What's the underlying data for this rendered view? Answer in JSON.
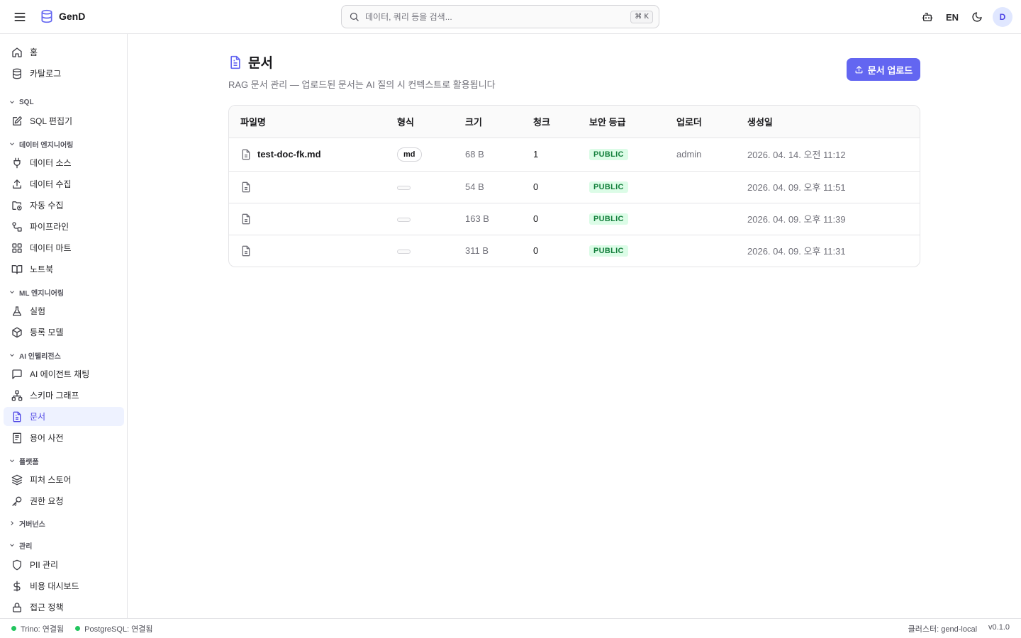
{
  "header": {
    "brand": "GenD",
    "search_placeholder": "데이터, 쿼리 등을 검색...",
    "search_shortcut": "⌘ K",
    "language": "EN",
    "avatar_initial": "D"
  },
  "sidebar": {
    "home": "홈",
    "catalog": "카탈로그",
    "sections": {
      "sql": "SQL",
      "data_engineering": "데이터 엔지니어링",
      "ml_engineering": "ML 엔지니어링",
      "ai_intelligence": "AI 인텔리전스",
      "platform": "플랫폼",
      "governance": "거버넌스",
      "admin": "관리"
    },
    "items": {
      "sql_editor": "SQL 편집기",
      "data_sources": "데이터 소스",
      "data_ingest": "데이터 수집",
      "auto_ingest": "자동 수집",
      "pipeline": "파이프라인",
      "data_mart": "데이터 마트",
      "notebook": "노트북",
      "experiments": "실험",
      "registered_models": "등록 모델",
      "ai_agent_chat": "AI 에이전트 채팅",
      "schema_graph": "스키마 그래프",
      "documents": "문서",
      "glossary": "용어 사전",
      "feature_store": "피처 스토어",
      "access_request": "권한 요청",
      "pii_management": "PII 관리",
      "cost_dashboard": "비용 대시보드",
      "access_policy": "접근 정책"
    }
  },
  "page": {
    "title": "문서",
    "subtitle": "RAG 문서 관리 — 업로드된 문서는 AI 질의 시 컨텍스트로 활용됩니다",
    "upload_button": "문서 업로드"
  },
  "table": {
    "columns": [
      "파일명",
      "형식",
      "크기",
      "청크",
      "보안 등급",
      "업로더",
      "생성일"
    ],
    "rows": [
      {
        "filename": "test-doc-fk.md",
        "format": "md",
        "size": "68 B",
        "chunks": "1",
        "security": "PUBLIC",
        "uploader": "admin",
        "created": "2026. 04. 14. 오전 11:12"
      },
      {
        "filename": "",
        "format": "",
        "size": "54 B",
        "chunks": "0",
        "security": "PUBLIC",
        "uploader": "",
        "created": "2026. 04. 09. 오후 11:51"
      },
      {
        "filename": "",
        "format": "",
        "size": "163 B",
        "chunks": "0",
        "security": "PUBLIC",
        "uploader": "",
        "created": "2026. 04. 09. 오후 11:39"
      },
      {
        "filename": "",
        "format": "",
        "size": "311 B",
        "chunks": "0",
        "security": "PUBLIC",
        "uploader": "",
        "created": "2026. 04. 09. 오후 11:31"
      }
    ]
  },
  "status": {
    "trino": "Trino: 연결됨",
    "postgres": "PostgreSQL: 연결됨",
    "cluster": "클러스터: gend-local",
    "version": "v0.1.0"
  },
  "colors": {
    "accent": "#6366f1",
    "active_bg": "#eef2ff",
    "public_badge_bg": "#dcfce7",
    "public_badge_text": "#15803d",
    "connected_dot": "#22c55e"
  }
}
